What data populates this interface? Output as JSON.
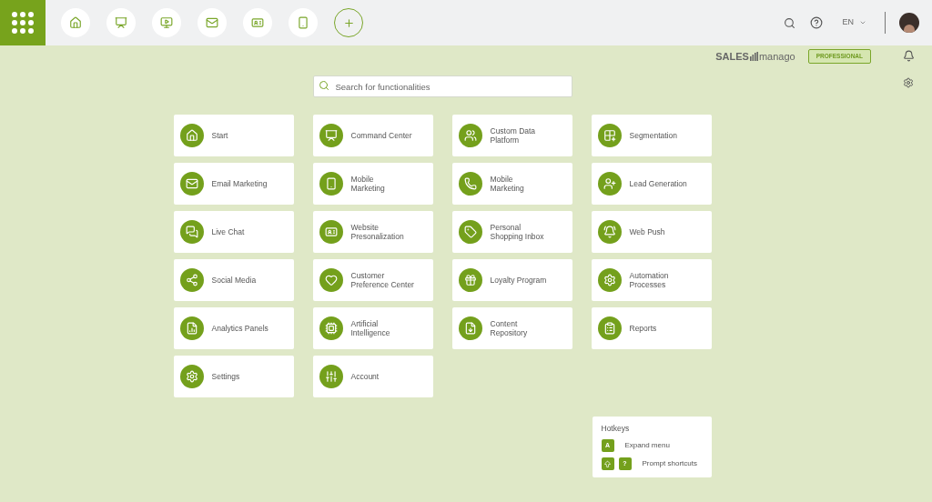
{
  "topbar": {
    "language": "EN"
  },
  "brand": {
    "name_left": "SALES",
    "name_right": "manago",
    "plan": "PROFESSIONAL"
  },
  "search": {
    "placeholder": "Search for functionalities"
  },
  "modules": [
    {
      "lines": [
        "Start"
      ]
    },
    {
      "lines": [
        "Command Center"
      ]
    },
    {
      "lines": [
        "Custom Data",
        "Platform"
      ]
    },
    {
      "lines": [
        "Segmentation"
      ]
    },
    {
      "lines": [
        "Email Marketing"
      ]
    },
    {
      "lines": [
        "Mobile",
        "Marketing"
      ]
    },
    {
      "lines": [
        "Mobile",
        "Marketing"
      ]
    },
    {
      "lines": [
        "Lead Generation"
      ]
    },
    {
      "lines": [
        "Live Chat"
      ]
    },
    {
      "lines": [
        "Website",
        "Presonalization"
      ]
    },
    {
      "lines": [
        "Personal",
        "Shopping Inbox"
      ]
    },
    {
      "lines": [
        "Web Push"
      ]
    },
    {
      "lines": [
        "Social Media"
      ]
    },
    {
      "lines": [
        "Customer",
        "Preference Center"
      ]
    },
    {
      "lines": [
        "Loyalty Program"
      ]
    },
    {
      "lines": [
        "Automation",
        "Processes"
      ]
    },
    {
      "lines": [
        "Analytics Panels"
      ]
    },
    {
      "lines": [
        "Artificial",
        "Intelligence"
      ]
    },
    {
      "lines": [
        "Content",
        "Repository"
      ]
    },
    {
      "lines": [
        "Reports"
      ]
    },
    {
      "lines": [
        "Settings"
      ]
    },
    {
      "lines": [
        "Account"
      ]
    }
  ],
  "hotkeys": {
    "title": "Hotkeys",
    "rows": [
      {
        "keys": [
          {
            "kind": "text",
            "label": "A"
          }
        ],
        "label": "Expand menu"
      },
      {
        "keys": [
          {
            "kind": "icon"
          },
          {
            "kind": "text",
            "label": "?"
          }
        ],
        "label": "Prompt shortcuts"
      }
    ]
  }
}
